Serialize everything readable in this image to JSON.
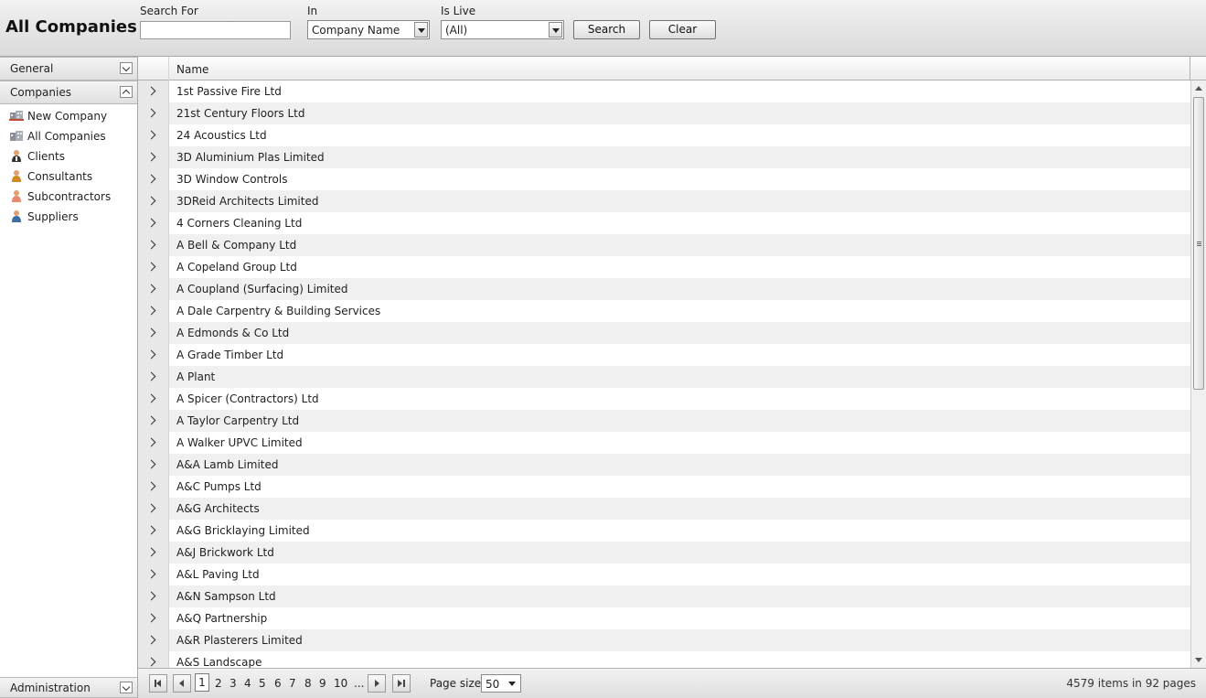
{
  "header": {
    "title": "All Companies",
    "search_for_label": "Search For",
    "search_value": "",
    "in_label": "In",
    "in_value": "Company Name",
    "is_live_label": "Is Live",
    "is_live_value": "(All)",
    "search_button": "Search",
    "clear_button": "Clear"
  },
  "sidebar": {
    "sections": [
      {
        "label": "General",
        "state": "collapsed"
      },
      {
        "label": "Companies",
        "state": "expanded"
      },
      {
        "label": "Administration",
        "state": "collapsed"
      }
    ],
    "items": [
      {
        "label": "New Company",
        "icon": "buildings-icon"
      },
      {
        "label": "All Companies",
        "icon": "buildings-icon"
      },
      {
        "label": "Clients",
        "icon": "client-person-icon"
      },
      {
        "label": "Consultants",
        "icon": "consultant-person-icon"
      },
      {
        "label": "Subcontractors",
        "icon": "subcontractor-person-icon"
      },
      {
        "label": "Suppliers",
        "icon": "supplier-person-icon"
      }
    ]
  },
  "grid": {
    "column_header": "Name",
    "rows": [
      "1st Passive Fire Ltd",
      "21st Century Floors Ltd",
      "24 Acoustics Ltd",
      "3D Aluminium Plas Limited",
      "3D Window Controls",
      "3DReid Architects Limited",
      "4 Corners Cleaning Ltd",
      "A Bell & Company Ltd",
      "A Copeland Group Ltd",
      "A Coupland (Surfacing) Limited",
      "A Dale Carpentry & Building Services",
      "A Edmonds & Co Ltd",
      "A Grade Timber Ltd",
      "A Plant",
      "A Spicer (Contractors) Ltd",
      "A Taylor Carpentry Ltd",
      "A Walker UPVC Limited",
      "A&A Lamb Limited",
      "A&C Pumps Ltd",
      "A&G Architects",
      "A&G Bricklaying Limited",
      "A&J Brickwork Ltd",
      "A&L Paving Ltd",
      "A&N Sampson Ltd",
      "A&Q Partnership",
      "A&R Plasterers Limited",
      "A&S Landscape"
    ]
  },
  "pager": {
    "pages": [
      "1",
      "2",
      "3",
      "4",
      "5",
      "6",
      "7",
      "8",
      "9",
      "10",
      "..."
    ],
    "current_page": "1",
    "page_size_label": "Page size:",
    "page_size_value": "50",
    "info": "4579 items in 92 pages"
  },
  "colors": {
    "toolbar_bg": "#e2e2e2",
    "row_alt": "#f0f0f0",
    "expander_cell": "#e8e8e8"
  }
}
